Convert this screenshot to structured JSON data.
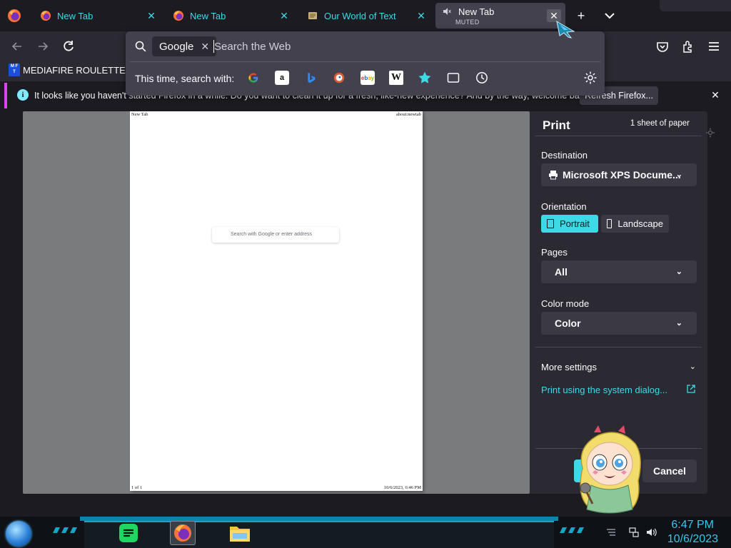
{
  "tabs": [
    {
      "title": "New Tab",
      "favicon": "firefox-icon"
    },
    {
      "title": "New Tab",
      "favicon": "firefox-icon"
    },
    {
      "title": "Our World of Text",
      "favicon": "scroll-icon"
    },
    {
      "title": "New Tab",
      "subtitle": "MUTED",
      "favicon": "muted-speaker-icon",
      "active": true
    }
  ],
  "urlbar": {
    "engine": "Google",
    "placeholder": "Search the Web",
    "oneoff_label": "This time, search with:",
    "oneoffs": [
      "google-icon",
      "amazon-icon",
      "bing-icon",
      "duckduckgo-icon",
      "ebay-icon",
      "wikipedia-icon",
      "bookmarks-star-icon",
      "tabs-icon",
      "history-icon"
    ]
  },
  "bookmarks": {
    "items": [
      {
        "label": "MEDIAFIRE ROULETTER",
        "logo": "MF T"
      }
    ]
  },
  "notification": {
    "text": "It looks like you haven't started Firefox in a while. Do you want to clean it up for a fresh, like-new experience? And by the way, welcome back!",
    "button": "Refresh Firefox..."
  },
  "preview": {
    "header_left": "New Tab",
    "header_right": "about:newtab",
    "search_placeholder": "Search with Google or enter address",
    "footer_left": "1 of 1",
    "footer_right": "10/6/2023, 6:46 PM"
  },
  "print": {
    "title": "Print",
    "sheets": "1 sheet of paper",
    "destination_label": "Destination",
    "destination_value": "Microsoft XPS Docume...",
    "orientation_label": "Orientation",
    "portrait": "Portrait",
    "landscape": "Landscape",
    "pages_label": "Pages",
    "pages_value": "All",
    "color_label": "Color mode",
    "color_value": "Color",
    "more_settings": "More settings",
    "system_dialog": "Print using the system dialog...",
    "cancel": "Cancel"
  },
  "taskbar": {
    "time": "6:47 PM",
    "date": "10/6/2023",
    "apps": [
      "spotify-icon",
      "firefox-icon",
      "file-explorer-icon"
    ]
  },
  "colors": {
    "accent": "#3dd9e6",
    "notification_border": "#d946ef",
    "clock": "#35c7ee"
  }
}
